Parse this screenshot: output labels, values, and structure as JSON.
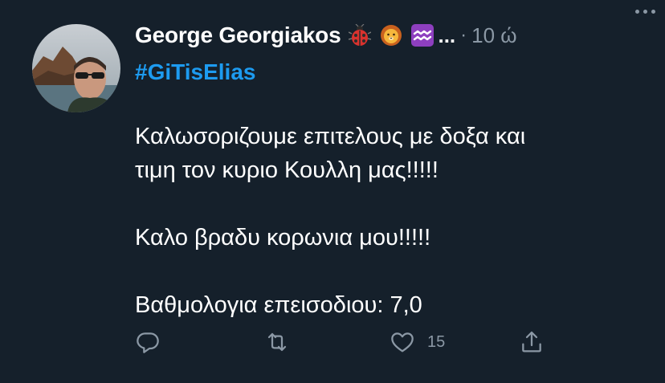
{
  "tweet": {
    "author": "George Georgiakos",
    "badges": [
      "ladybug-emoji",
      "lion-emoji",
      "aquarius-emoji"
    ],
    "truncation": "...",
    "separator": "·",
    "timestamp": "10 ώ",
    "hashtag": "#GiTisElias",
    "body_lines": [
      "Καλωσοριζουμε επιτελους με δοξα και",
      "τιμη τον κυριο Κουλλη μας!!!!!",
      "Καλο βραδυ κορωνια μου!!!!!",
      "Βαθμολογια επεισοδιου: 7,0"
    ],
    "actions": {
      "reply_icon": "reply-icon",
      "retweet_icon": "retweet-icon",
      "like_icon": "like-icon",
      "like_count": "15",
      "share_icon": "share-icon"
    }
  },
  "colors": {
    "background": "#15202b",
    "text": "#ffffff",
    "muted": "#8b98a5",
    "accent": "#1d9bf0"
  }
}
